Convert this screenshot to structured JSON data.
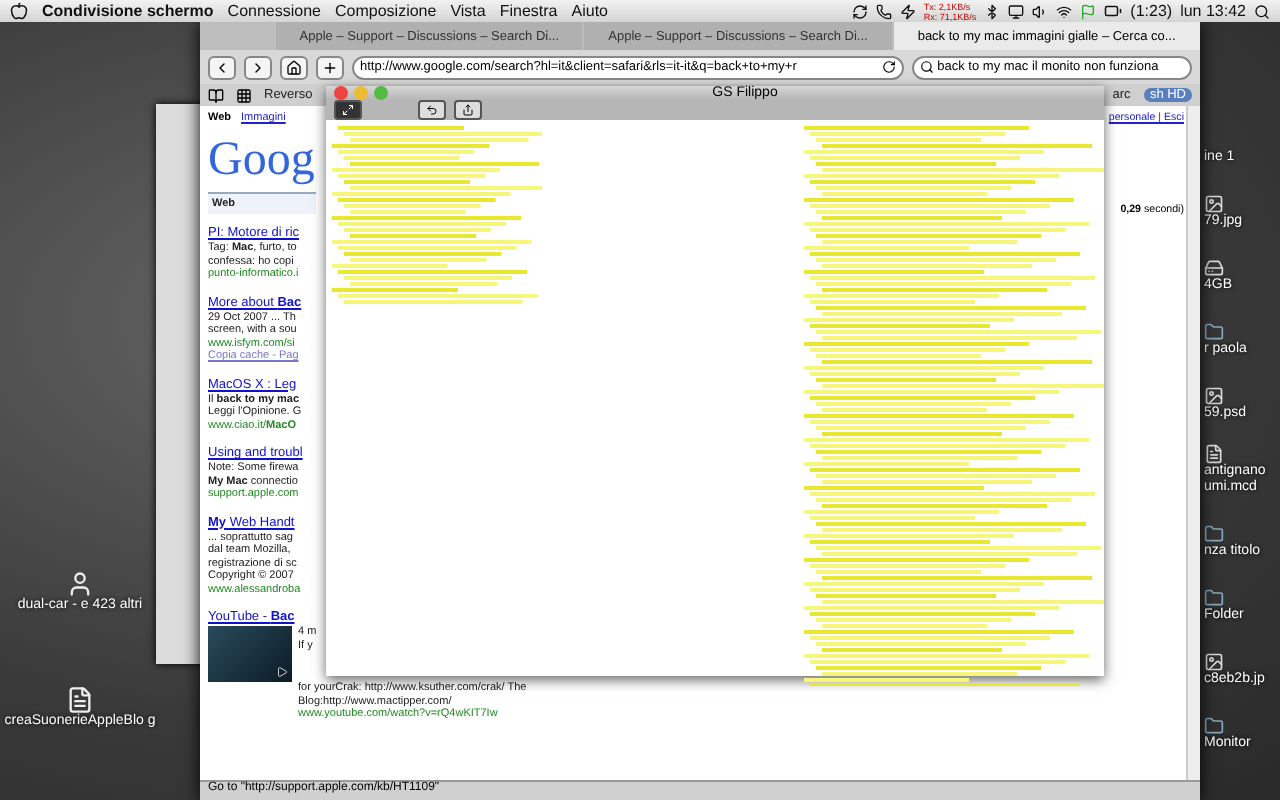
{
  "menu_bar": {
    "app": "Condivisione schermo",
    "menus": [
      "Connessione",
      "Composizione",
      "Vista",
      "Finestra",
      "Aiuto"
    ],
    "net_tx": "Tx: 2,1KB/s",
    "net_rx": "Rx: 71,1KB/s",
    "battery": "(1:23)",
    "clock": "lun 13:42"
  },
  "browser": {
    "tabs": [
      {
        "label": "Apple – Support – Discussions – Search Di...",
        "selected": false
      },
      {
        "label": "Apple – Support – Discussions – Search Di...",
        "selected": false
      },
      {
        "label": "back to my mac immagini gialle – Cerca co...",
        "selected": true
      }
    ],
    "url": "http://www.google.com/search?hl=it&client=safari&rls=it-it&q=back+to+my+r",
    "search": "back to my mac il monito non funziona",
    "bookmarks": [
      "Reverso",
      "arc"
    ],
    "side_pill": "sh HD",
    "google": {
      "nav": [
        {
          "label": "Web",
          "selected": true
        },
        {
          "label": "Immagini",
          "selected": false
        }
      ],
      "account": "personale | Esci",
      "logo": "Goog",
      "section": "Web",
      "time": "**0,29** secondi)",
      "results": [
        {
          "kind": "text",
          "title": "PI: Motore di ric",
          "lines": [
            "Tag: **Mac**, furto, to",
            "confessa: ho copi"
          ],
          "url": "punto-informatico.i"
        },
        {
          "kind": "text",
          "title": "More about **Bac**",
          "lines": [
            "29 Oct 2007 ... Th",
            "screen, with a sou"
          ],
          "url": "www.isfym.com/si",
          "cache": "Copia cache - Pag"
        },
        {
          "kind": "text",
          "title": "MacOS X : Leg",
          "lines": [
            "Il **back to my mac**",
            "Leggi l'Opinione. G"
          ],
          "url": "www.ciao.it/**MacO**"
        },
        {
          "kind": "text",
          "title": "Using and troubl",
          "lines": [
            "Note: Some firewa",
            "**My Mac** connectio"
          ],
          "url": "support.apple.com"
        },
        {
          "kind": "text",
          "title": "**My** Web Handt",
          "lines": [
            "... soprattutto sag",
            "dal team Mozilla,",
            "registrazione di sc",
            "Copyright © 2007"
          ],
          "url": "www.alessandroba"
        },
        {
          "kind": "video",
          "title": "YouTube - **Bac**",
          "lines": [
            "4 m",
            "If y"
          ],
          "wide_lines": [
            "for yourCrak: http://www.ksuther.com/crak/ The",
            "Blog:http://www.mactipper.com/"
          ],
          "url": "www.youtube.com/watch?v=rQ4wKIT7Iw"
        }
      ]
    },
    "status": "Go to \"http://support.apple.com/kb/HT1109\""
  },
  "viewer": {
    "title": "GS Filippo"
  },
  "desktop_right": [
    {
      "label": "ine 1",
      "kind": "none"
    },
    {
      "label": "79.jpg",
      "kind": "image"
    },
    {
      "label": "4GB",
      "kind": "drive"
    },
    {
      "label": "r paola",
      "kind": "folder"
    },
    {
      "label": "59.psd",
      "kind": "image"
    },
    {
      "label": "antignano umi.mcd",
      "kind": "doc"
    },
    {
      "label": "nza titolo",
      "kind": "folder"
    },
    {
      "label": "Folder",
      "kind": "folder"
    },
    {
      "label": "c8eb2b.jp",
      "kind": "image"
    },
    {
      "label": "Monitor",
      "kind": "folder"
    }
  ],
  "desktop_left": [
    {
      "label": "dual-car - e 423 altri",
      "kind": "alias"
    },
    {
      "label": "creaSuonerieAppleBlo g",
      "kind": "script"
    }
  ]
}
